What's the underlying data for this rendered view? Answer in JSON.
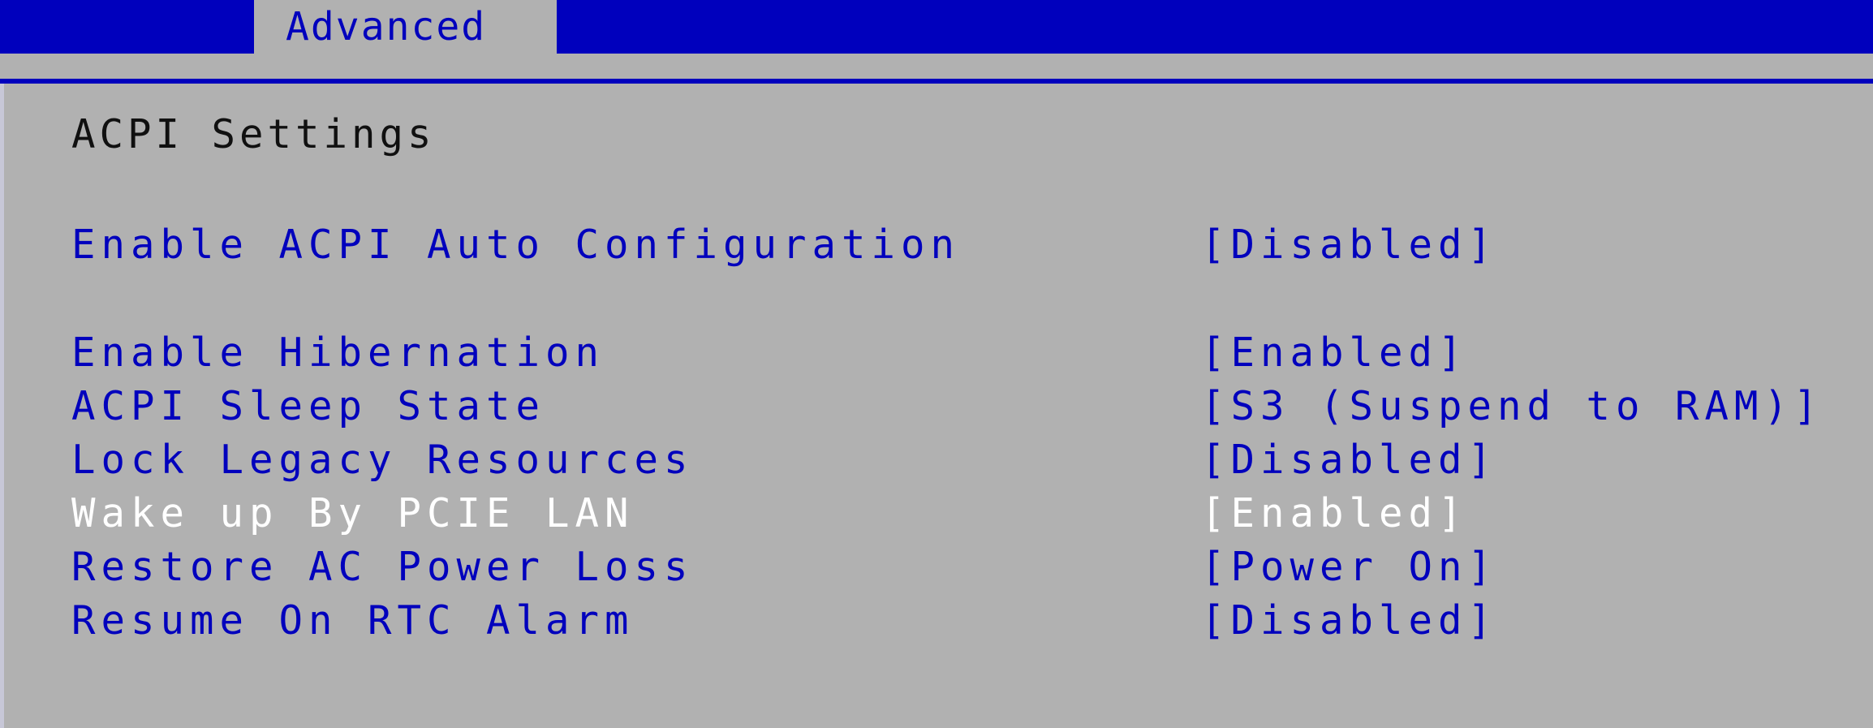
{
  "header": {
    "tab_label": "Advanced"
  },
  "page": {
    "section_title": "ACPI Settings"
  },
  "settings": [
    {
      "label": "Enable ACPI Auto Configuration",
      "value": "[Disabled]"
    },
    {
      "label": "Enable Hibernation",
      "value": "[Enabled]"
    },
    {
      "label": "ACPI Sleep State",
      "value": "[S3 (Suspend to RAM)]"
    },
    {
      "label": "Lock Legacy Resources",
      "value": "[Disabled]"
    },
    {
      "label": "Wake up By PCIE LAN",
      "value": "[Enabled]",
      "selected": true
    },
    {
      "label": "Restore AC Power Loss",
      "value": "[Power On]"
    },
    {
      "label": "Resume On RTC Alarm",
      "value": "[Disabled]"
    }
  ],
  "colors": {
    "accent_blue": "#0000bd",
    "panel_gray": "#b1b1b1",
    "selected_text": "#ffffff",
    "title_text": "#101010"
  }
}
